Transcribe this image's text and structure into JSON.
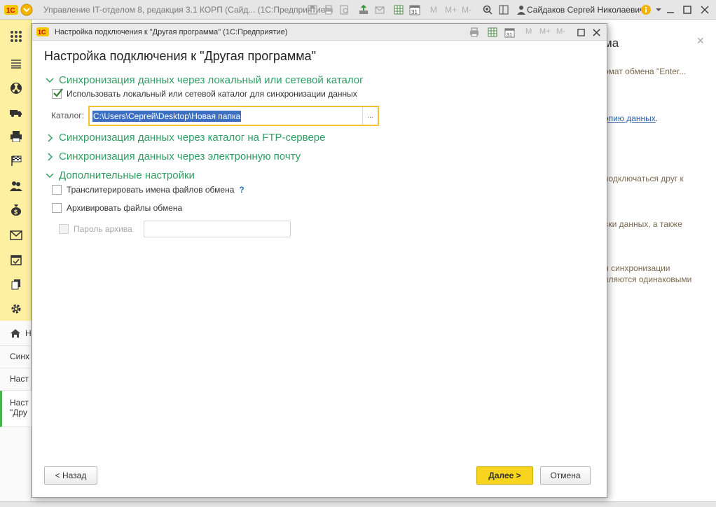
{
  "app": {
    "title": "Управление IT-отделом 8, редакция 3.1 КОРП (Сайд...  (1С:Предприятие)",
    "user": "Сайдаков Сергей Николаевич",
    "m_buttons": [
      "M",
      "M+",
      "M-"
    ],
    "calendar_day": "31"
  },
  "left_nav": {
    "sections": [
      "apps-icon",
      "menu-icon",
      "radiation-icon",
      "truck-icon",
      "printer-icon",
      "checkered-flag-icon",
      "people-icon",
      "money-bag-icon",
      "envelope-icon",
      "calendar-check-icon",
      "documents-icon",
      "gear-icon"
    ],
    "home_label": "Н",
    "items": [
      "Синх",
      "Наст",
      "Наст \"Дру"
    ]
  },
  "background_form": {
    "title": "ма",
    "text_lines": [
      "омат обмена \"Enter...",
      "подключаться друг к",
      "вки данных, а также",
      "и синхронизации",
      "яляются одинаковыми"
    ],
    "link": "опию данных",
    "link_suffix": "."
  },
  "dialog": {
    "window_title": "Настройка подключения к \"Другая программа\"  (1С:Предприятие)",
    "header": "Настройка подключения к \"Другая программа\"",
    "m_buttons": [
      "M",
      "M+",
      "M-"
    ],
    "calendar_day": "31",
    "groups": {
      "local": {
        "label": "Синхронизация данных через локальный или сетевой каталог",
        "expanded": true,
        "use_checkbox_label": "Использовать локальный или сетевой каталог для синхронизации данных",
        "use_checked": true,
        "catalog_label": "Каталог:",
        "catalog_value": "C:\\Users\\Сергей\\Desktop\\Новая папка",
        "browse_label": "..."
      },
      "ftp": {
        "label": "Синхронизация данных через каталог на FTP-сервере",
        "expanded": false
      },
      "email": {
        "label": "Синхронизация данных через электронную почту",
        "expanded": false
      },
      "extra": {
        "label": "Дополнительные настройки",
        "expanded": true,
        "transliterate_label": "Транслитерировать имена файлов обмена",
        "transliterate_checked": false,
        "help_mark": "?",
        "archive_label": "Архивировать файлы обмена",
        "archive_checked": false,
        "password_label": "Пароль архива",
        "password_checked": false,
        "password_value": ""
      }
    },
    "buttons": {
      "back": "< Назад",
      "next": "Далее >",
      "cancel": "Отмена"
    }
  }
}
